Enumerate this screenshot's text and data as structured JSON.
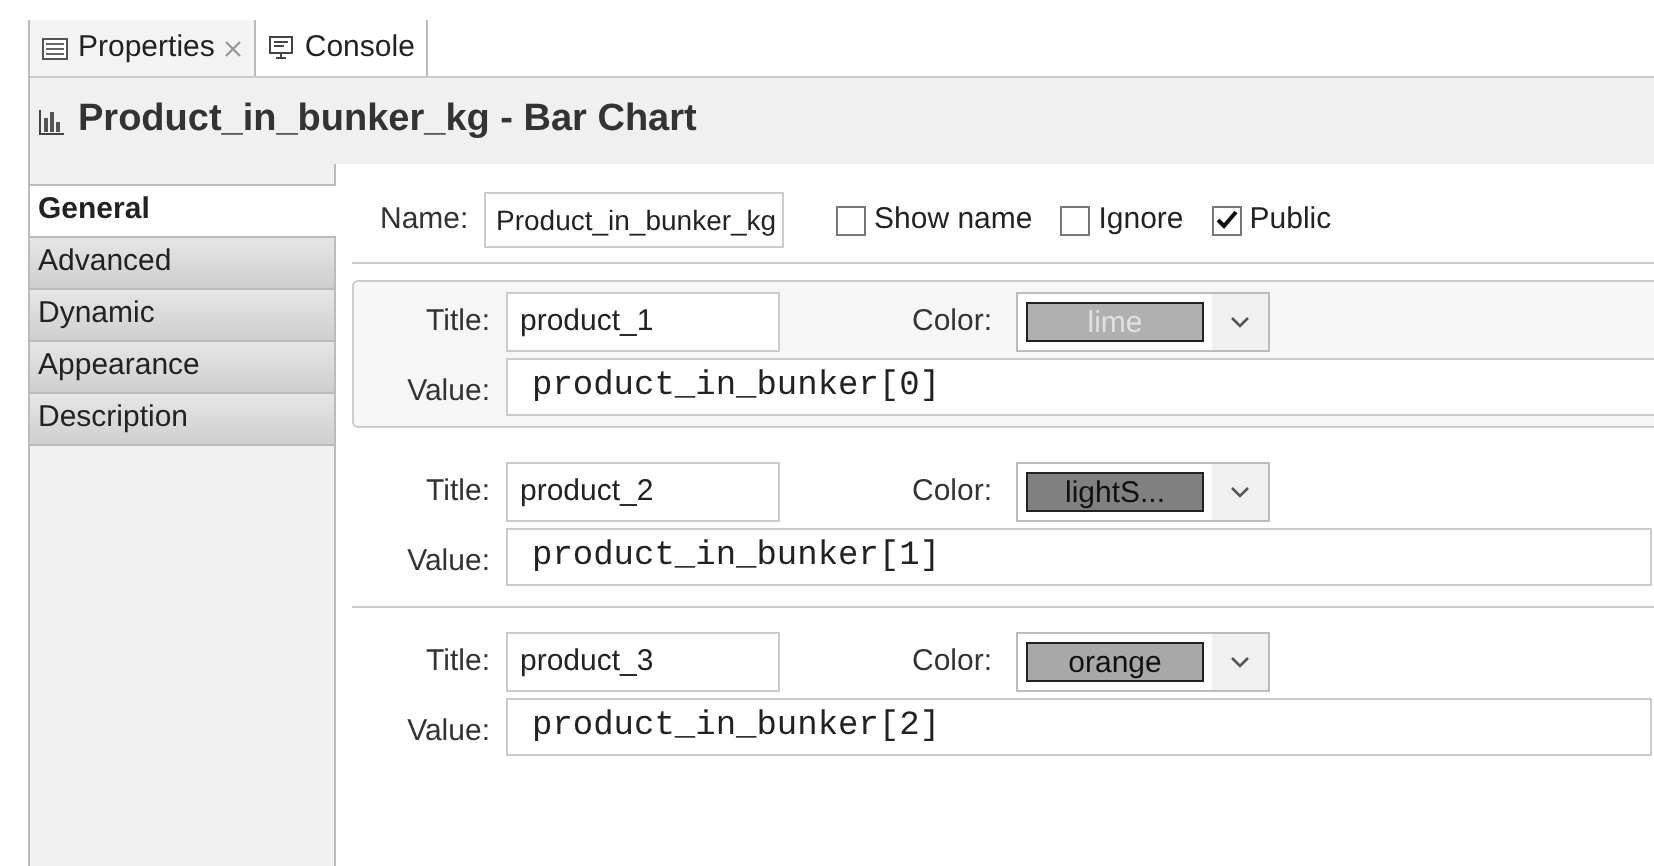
{
  "tabs": [
    {
      "label": "Properties",
      "selected": true,
      "closable": true
    },
    {
      "label": "Console",
      "selected": false,
      "closable": false
    }
  ],
  "header": {
    "title": "Product_in_bunker_kg - Bar Chart"
  },
  "sidebar": {
    "items": [
      {
        "label": "General",
        "selected": true
      },
      {
        "label": "Advanced",
        "selected": false
      },
      {
        "label": "Dynamic",
        "selected": false
      },
      {
        "label": "Appearance",
        "selected": false
      },
      {
        "label": "Description",
        "selected": false
      }
    ]
  },
  "general": {
    "name_label": "Name:",
    "name_value": "Product_in_bunker_kg",
    "checkboxes": [
      {
        "label": "Show name",
        "checked": false
      },
      {
        "label": "Ignore",
        "checked": false
      },
      {
        "label": "Public",
        "checked": true
      }
    ]
  },
  "series": [
    {
      "title_label": "Title:",
      "title": "product_1",
      "color_label": "Color:",
      "color_name": "lime",
      "color": "#b0b0b0",
      "value_label": "Value:",
      "value": "product_in_bunker[0]",
      "selected": true
    },
    {
      "title_label": "Title:",
      "title": "product_2",
      "color_label": "Color:",
      "color_name": "lightS...",
      "color": "#808080",
      "value_label": "Value:",
      "value": "product_in_bunker[1]",
      "selected": false
    },
    {
      "title_label": "Title:",
      "title": "product_3",
      "color_label": "Color:",
      "color_name": "orange",
      "color": "#a8a8a8",
      "value_label": "Value:",
      "value": "product_in_bunker[2]",
      "selected": false
    }
  ]
}
